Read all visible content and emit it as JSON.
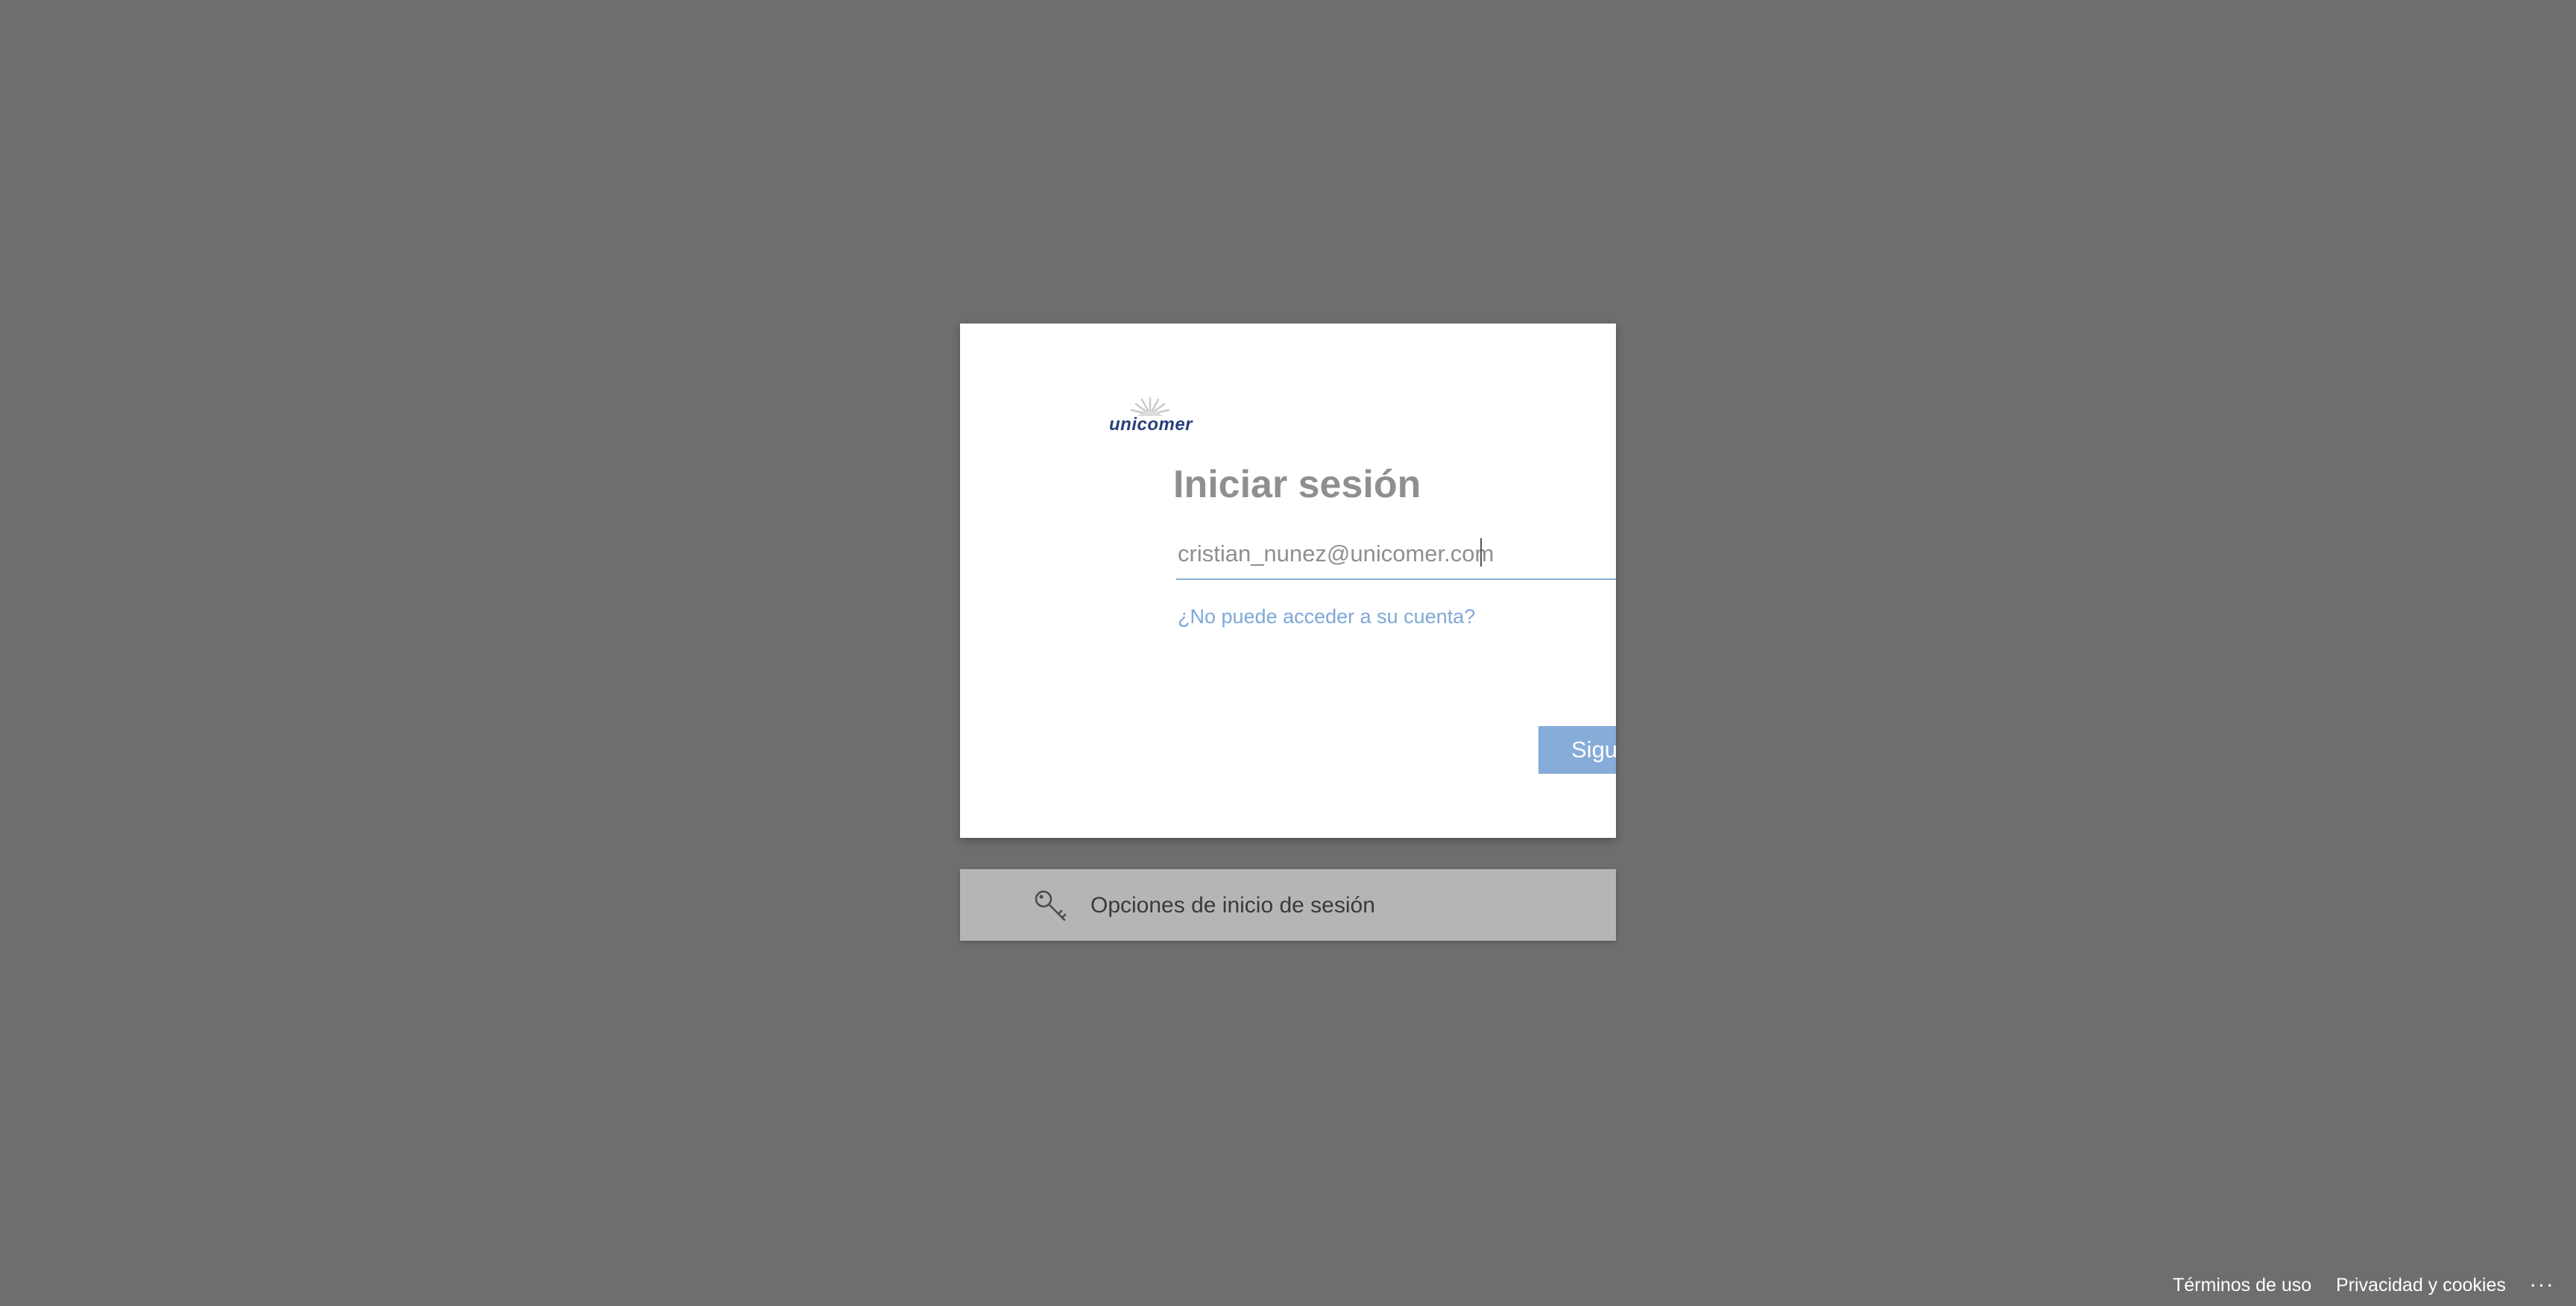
{
  "logo": {
    "text": "unicomer",
    "brand_color": "#2a3f7a"
  },
  "signin": {
    "title": "Iniciar sesión",
    "email_value": "cristian_nunez@unicomer.com",
    "cant_access_link": "¿No puede acceder a su cuenta?",
    "next_label": "Sigu",
    "accent_color": "#86acd9"
  },
  "options": {
    "label": "Opciones de inicio de sesión",
    "icon": "key-icon"
  },
  "footer": {
    "terms": "Términos de uso",
    "privacy": "Privacidad y cookies",
    "more": "..."
  },
  "colors": {
    "background": "#6e6e6e",
    "card": "#ffffff",
    "options_bar": "#b5b5b5",
    "link": "#7ea8d8"
  }
}
